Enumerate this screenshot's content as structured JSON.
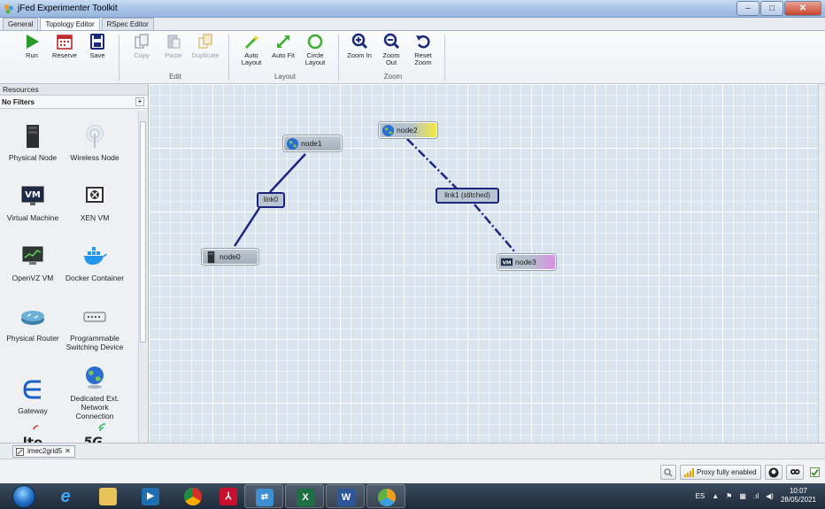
{
  "window": {
    "title": "jFed Experimenter Toolkit",
    "minimize": "–",
    "maximize": "□",
    "close": "✕"
  },
  "menu_tabs": [
    "General",
    "Topology Editor",
    "RSpec Editor"
  ],
  "ribbon": {
    "run": "Run",
    "reserve": "Reserve",
    "save": "Save",
    "copy": "Copy",
    "paste": "Paste",
    "duplicate": "Duplicate",
    "edit_group": "Edit",
    "auto_layout": "Auto Layout",
    "auto_fit": "Auto Fit",
    "circle_layout": "Circle Layout",
    "layout_group": "Layout",
    "zoom_in": "Zoom In",
    "zoom_out": "Zoom Out",
    "reset_zoom": "Reset Zoom",
    "zoom_group": "Zoom"
  },
  "resources": {
    "header": "Resources",
    "filter": "No Filters",
    "filter_add": "+",
    "items": [
      {
        "label": "Physical Node",
        "icon": "server-icon"
      },
      {
        "label": "Wireless Node",
        "icon": "antenna-icon"
      },
      {
        "label": "Virtual Machine",
        "icon": "vm-icon"
      },
      {
        "label": "XEN VM",
        "icon": "xen-icon"
      },
      {
        "label": "OpenVZ VM",
        "icon": "monitor-icon"
      },
      {
        "label": "Docker Container",
        "icon": "docker-icon"
      },
      {
        "label": "Physical Router",
        "icon": "router-icon"
      },
      {
        "label": "Programmable Switching Device",
        "icon": "switch-icon"
      },
      {
        "label": "Gateway",
        "icon": "gateway-icon"
      },
      {
        "label": "Dedicated Ext. Network Connection",
        "icon": "globe-icon"
      },
      {
        "label": "lte",
        "icon": "lte-icon"
      },
      {
        "label": "5G",
        "icon": "5g-icon"
      }
    ]
  },
  "topology": {
    "nodes": [
      {
        "id": "node1",
        "label": "node1",
        "icon": "globe-icon",
        "accent": ""
      },
      {
        "id": "node2",
        "label": "node2",
        "icon": "globe-icon",
        "accent": "#f2ea3c"
      },
      {
        "id": "node0",
        "label": "node0",
        "icon": "server-icon",
        "accent": ""
      },
      {
        "id": "node3",
        "label": "node3",
        "icon": "vm-icon",
        "accent": "#d98ee6"
      }
    ],
    "links": [
      {
        "id": "link0",
        "label": "link0",
        "style": "solid"
      },
      {
        "id": "link1",
        "label": "link1 (stitched)",
        "style": "dashed"
      }
    ]
  },
  "slice_tab": {
    "label": "imec2grid5",
    "close": "✕"
  },
  "status": {
    "proxy": "Proxy fully enabled"
  },
  "taskbar": {
    "language": "ES",
    "time": "10:07",
    "date": "28/05/2021"
  },
  "colors": {
    "link": "#1c2680",
    "canvas": "#d9e4ee"
  }
}
